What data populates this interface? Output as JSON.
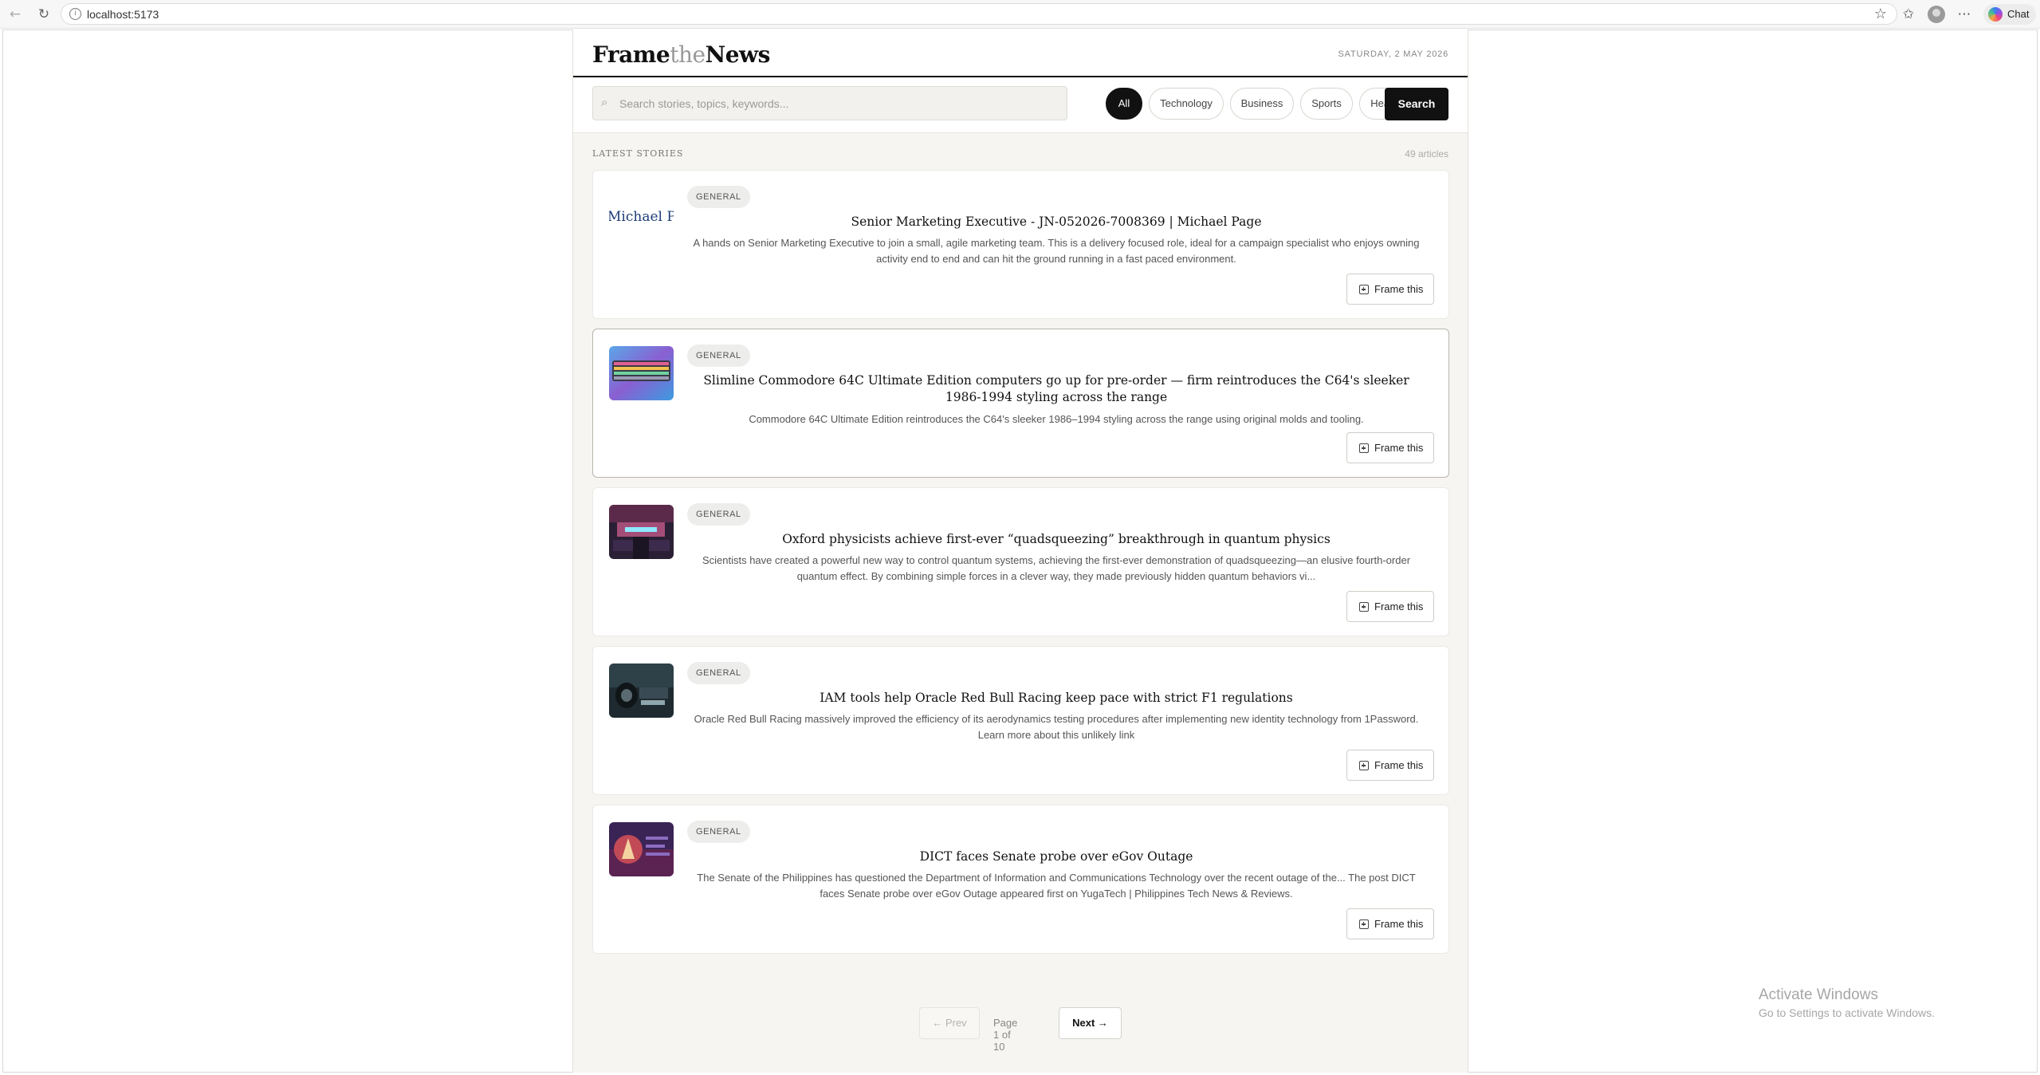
{
  "browser": {
    "url": "localhost:5173",
    "chat_label": "Chat"
  },
  "masthead": {
    "logo_part1": "Frame",
    "logo_part2": "the",
    "logo_part3": "News",
    "date": "SATURDAY, 2 MAY 2026"
  },
  "search": {
    "placeholder": "Search stories, topics, keywords...",
    "value": "",
    "button_label": "Search"
  },
  "categories": [
    {
      "label": "All",
      "active": true
    },
    {
      "label": "Technology",
      "active": false
    },
    {
      "label": "Business",
      "active": false
    },
    {
      "label": "Sports",
      "active": false
    },
    {
      "label": "Health",
      "active": false
    }
  ],
  "section": {
    "label": "LATEST STORIES",
    "count": "49 articles"
  },
  "articles": [
    {
      "category": "GENERAL",
      "title": "Senior Marketing Executive - JN-052026-7008369 | Michael Page",
      "description": "A hands on Senior Marketing Executive to join a small, agile marketing team. This is a delivery focused role, ideal for a campaign specialist who enjoys owning activity end to end and can hit the ground running in a fast paced environment.",
      "thumb_text": "Michael Page",
      "action_label": "Frame this"
    },
    {
      "category": "GENERAL",
      "title": "Slimline Commodore 64C Ultimate Edition computers go up for pre-order — firm reintroduces the C64's sleeker 1986-1994 styling across the range",
      "description": "Commodore 64C Ultimate Edition reintroduces the C64's sleeker 1986–1994 styling across the range using original molds and tooling.",
      "action_label": "Frame this"
    },
    {
      "category": "GENERAL",
      "title": "Oxford physicists achieve first-ever “quadsqueezing” breakthrough in quantum physics",
      "description": "Scientists have created a powerful new way to control quantum systems, achieving the first-ever demonstration of quadsqueezing—an elusive fourth-order quantum effect. By combining simple forces in a clever way, they made previously hidden quantum behaviors vi...",
      "action_label": "Frame this"
    },
    {
      "category": "GENERAL",
      "title": "IAM tools help Oracle Red Bull Racing keep pace with strict F1 regulations",
      "description": "Oracle Red Bull Racing massively improved the efficiency of its aerodynamics testing procedures after implementing new identity technology from 1Password. Learn more about this unlikely link",
      "action_label": "Frame this"
    },
    {
      "category": "GENERAL",
      "title": "DICT faces Senate probe over eGov Outage",
      "description": "The Senate of the Philippines has questioned the Department of Information and Communications Technology over the recent outage of the... The post DICT faces Senate probe over eGov Outage appeared first on YugaTech | Philippines Tech News & Reviews.",
      "action_label": "Frame this"
    }
  ],
  "pagination": {
    "prev_label": "← Prev",
    "info": "Page 1 of 10",
    "next_label": "Next →"
  },
  "watermark": {
    "line1": "Activate Windows",
    "line2": "Go to Settings to activate Windows."
  }
}
